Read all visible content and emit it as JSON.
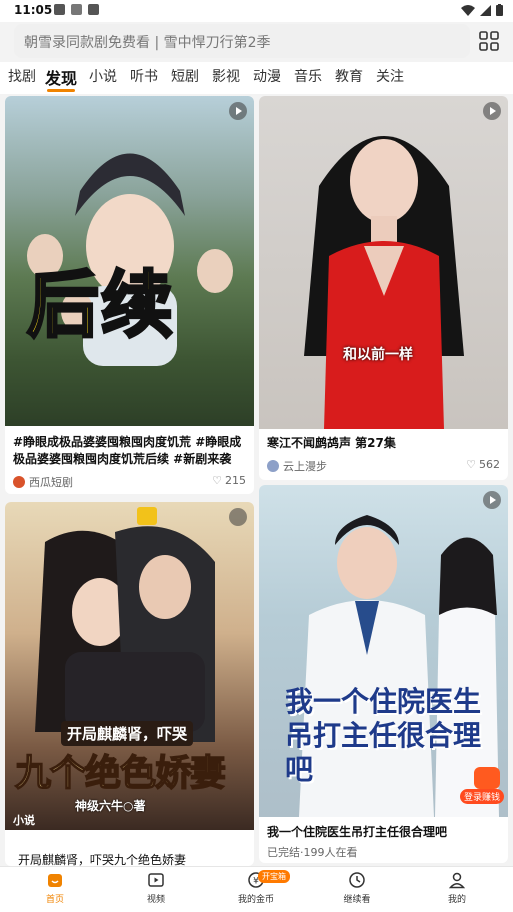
{
  "status": {
    "time": "11:05"
  },
  "search": {
    "placeholder": "朝雪录同款剧免费看 | 雪中悍刀行第2季"
  },
  "tabs": [
    "找剧",
    "发现",
    "小说",
    "听书",
    "短剧",
    "影视",
    "动漫",
    "音乐",
    "教育",
    "关注"
  ],
  "active_tab": "发现",
  "cards": [
    {
      "overlay_text": "后续",
      "title": "#睁眼成极品婆婆囤粮囤肉度饥荒 #睁眼成极品婆婆囤粮囤肉度饥荒后续 #新剧来袭 ...",
      "author": "西瓜短剧",
      "likes": "215"
    },
    {
      "overlay_text": "和以前一样",
      "title": "寒江不闻鹧鸪声 第27集",
      "author": "云上漫步",
      "likes": "562"
    },
    {
      "overlay_top": "开局麒麟肾，吓哭",
      "overlay_main": "九个绝色娇妻",
      "overlay_sub": "神级六牛○著",
      "tag": "小说",
      "title": "开局麒麟肾，吓哭九个绝色娇妻"
    },
    {
      "overlay_main": "我一个住院医生吊打主任很合理吧",
      "badge": "登录赚钱",
      "title": "我一个住院医生吊打主任很合理吧",
      "meta": "已完结·199人在看"
    }
  ],
  "nav": [
    {
      "label": "首页",
      "icon": "home-icon"
    },
    {
      "label": "视频",
      "icon": "video-icon"
    },
    {
      "label": "我的金币",
      "icon": "coin-icon"
    },
    {
      "label": "继续看",
      "icon": "clock-icon"
    },
    {
      "label": "我的",
      "icon": "user-icon"
    }
  ],
  "coin_badge": "开宝箱",
  "colors": {
    "accent": "#f08300",
    "red": "#d41818",
    "yellow": "#ffe21a"
  }
}
